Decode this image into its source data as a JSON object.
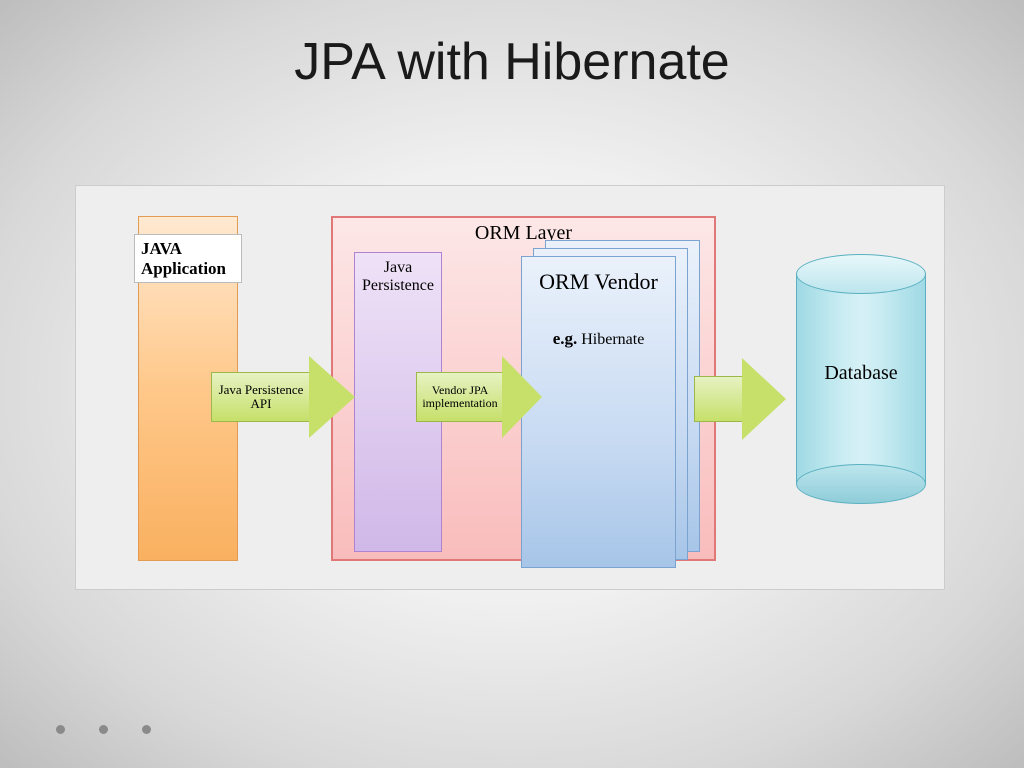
{
  "title": "JPA with Hibernate",
  "diagram": {
    "javaApp": "JAVA Application",
    "ormLayer": "ORM Layer",
    "javaPersistence": "Java Persistence",
    "vendorTitle": "ORM Vendor",
    "vendorExamplePrefix": "e.g.",
    "vendorExample": "Hibernate",
    "database": "Database",
    "arrow1": "Java Persistence API",
    "arrow2": "Vendor JPA implementation",
    "arrow3": ""
  }
}
